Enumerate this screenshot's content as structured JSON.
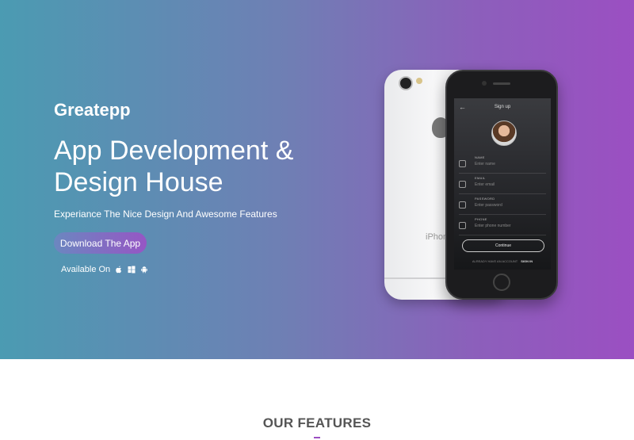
{
  "hero": {
    "brand": "Greatepp",
    "headline": "App Development & Design House",
    "subline": "Experiance The Nice Design And Awesome Features",
    "download_label": "Download The App",
    "available_label": "Available On",
    "platform_icons": [
      "apple-icon",
      "windows-icon",
      "android-icon"
    ]
  },
  "phone_screen": {
    "title": "Sign up",
    "fields": [
      {
        "label": "NAME",
        "placeholder": "Enter name"
      },
      {
        "label": "EMAIL",
        "placeholder": "Enter email"
      },
      {
        "label": "PASSWORD",
        "placeholder": "Enter password"
      },
      {
        "label": "PHONE",
        "placeholder": "Enter phone number"
      }
    ],
    "continue_label": "Continue",
    "already_text": "ALREADY HAVE AN ACCOUNT",
    "signin_label": "SIGN IN",
    "back_phone_brand": "iPhone"
  },
  "features": {
    "title": "OUR FEATURES"
  },
  "colors": {
    "gradient_start": "#4b9bb2",
    "gradient_end": "#9b4fc2",
    "accent": "#9656c4"
  }
}
